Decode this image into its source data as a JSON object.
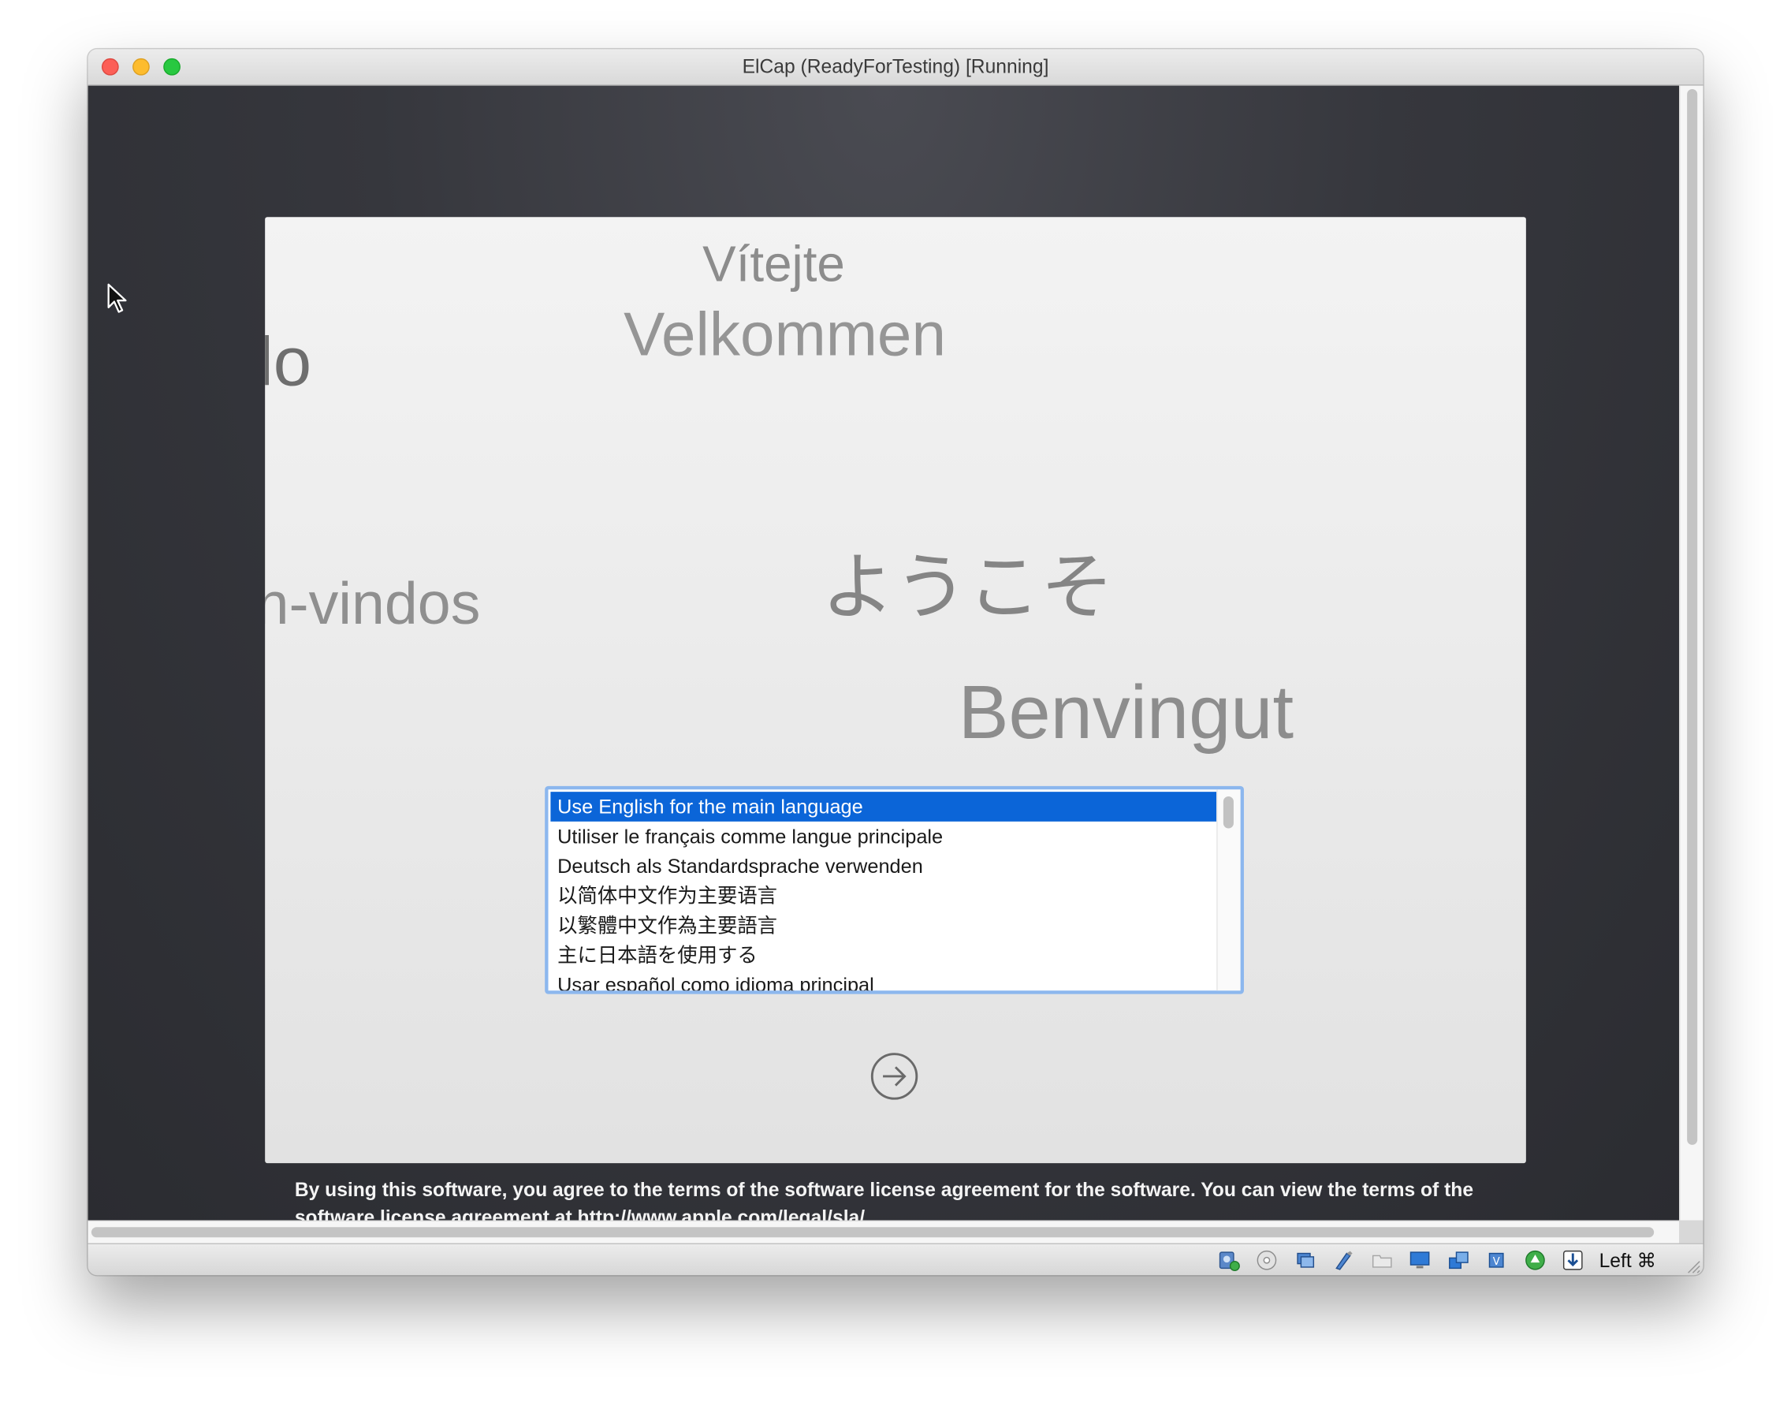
{
  "window": {
    "title": "ElCap (ReadyForTesting) [Running]"
  },
  "welcome": {
    "greetings": [
      "Vítejte",
      "Velkommen",
      "lo",
      "ようこそ",
      "n-vindos",
      "Benvingut"
    ]
  },
  "language_list": {
    "items": [
      {
        "label": "Use English for the main language",
        "selected": true
      },
      {
        "label": "Utiliser le français comme langue principale",
        "selected": false
      },
      {
        "label": "Deutsch als Standardsprache verwenden",
        "selected": false
      },
      {
        "label": "以简体中文作为主要语言",
        "selected": false
      },
      {
        "label": "以繁體中文作為主要語言",
        "selected": false
      },
      {
        "label": "主に日本語を使用する",
        "selected": false
      },
      {
        "label": "Usar español como idioma principal",
        "selected": false
      }
    ]
  },
  "license": {
    "text": "By using this software, you agree to the terms of the software license agreement for the software. You can view the terms of the software license agreement at http://www.apple.com/legal/sla/"
  },
  "statusbar": {
    "host_key": "Left ⌘",
    "icons": [
      "hard-disk-icon",
      "optical-drive-icon",
      "audio-icon",
      "usb-icon",
      "shared-folder-icon",
      "display-icon",
      "network-icon",
      "cpu-icon",
      "mouse-integration-icon",
      "download-icon"
    ]
  },
  "colors": {
    "selection": "#0b65d8",
    "list_focus_ring": "#8cb7ee",
    "vm_background": "#36373d"
  }
}
